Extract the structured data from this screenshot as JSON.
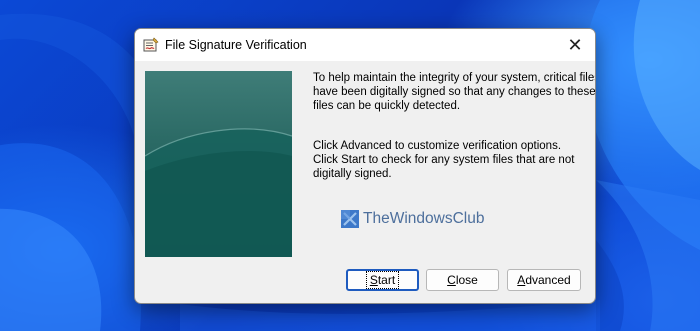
{
  "dialog": {
    "title": "File Signature Verification",
    "close_glyph": "✕",
    "app_icon": "file-signature-verification-icon"
  },
  "message": {
    "line1": "To help maintain the integrity of your system, critical files",
    "line2": "have been digitally signed so that any changes to these",
    "line3": "files can be quickly detected.",
    "line4": "Click Advanced to customize verification options.",
    "line5": "Click Start to check for any system files that are not",
    "line6": "digitally signed."
  },
  "watermark": {
    "text": "TheWindowsClub"
  },
  "buttons": {
    "start": {
      "first": "S",
      "rest": "tart"
    },
    "close": {
      "first": "C",
      "rest": "lose"
    },
    "advanced": {
      "first": "A",
      "rest": "dvanced"
    }
  },
  "colors": {
    "desktop": "#0a3fc4",
    "dialog_bg": "#f0f0f0",
    "banner": "#2a6964",
    "default_button_border": "#1e5bbf",
    "watermark_text": "#4d6f9c"
  }
}
